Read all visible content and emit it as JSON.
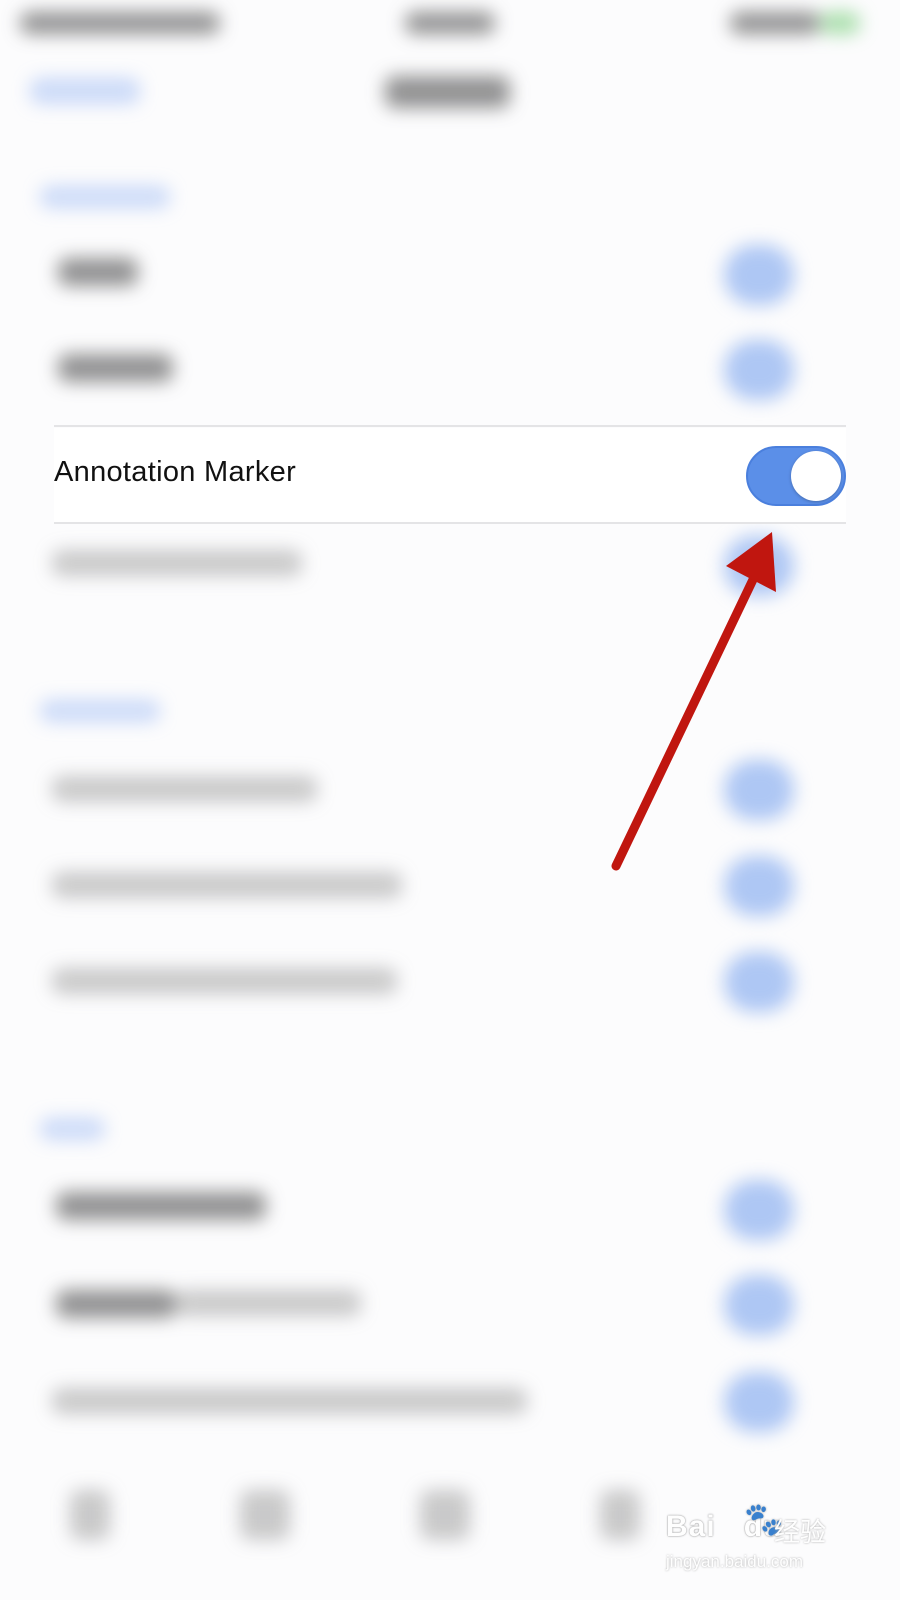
{
  "focused_setting": {
    "label": "Annotation Marker",
    "enabled": true
  },
  "colors": {
    "accent": "#5b8fe8",
    "arrow": "#c0160f",
    "background": "#fcfcfd"
  },
  "watermark": {
    "brand": "Bai",
    "brand_suffix": "du",
    "paw": "🐾",
    "service": "经验",
    "url": "jingyan.baidu.com"
  }
}
